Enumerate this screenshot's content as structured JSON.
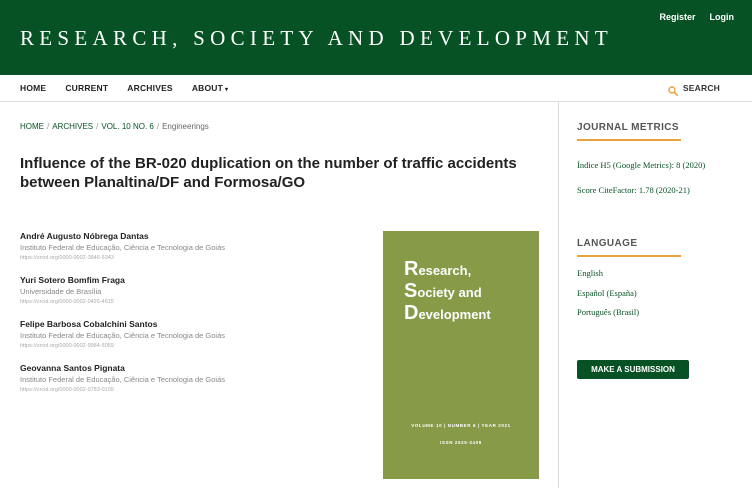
{
  "header": {
    "site_title": "RESEARCH, SOCIETY AND DEVELOPMENT",
    "register_label": "Register",
    "login_label": "Login",
    "background_color": "#075224"
  },
  "nav": {
    "items": [
      {
        "label": "HOME"
      },
      {
        "label": "CURRENT"
      },
      {
        "label": "ARCHIVES"
      },
      {
        "label": "ABOUT"
      }
    ],
    "about_caret": "▾",
    "search_label": "SEARCH",
    "search_icon": "search-icon",
    "accent_color": "#e8a33c"
  },
  "breadcrumb": {
    "items": [
      "HOME",
      "ARCHIVES",
      "VOL. 10 NO. 6"
    ],
    "separator": "/",
    "current": "Engineerings"
  },
  "article": {
    "title": "Influence of the BR-020 duplication on the number of traffic accidents between Planaltina/DF and Formosa/GO",
    "authors": [
      {
        "name": "André Augusto Nóbrega Dantas",
        "affiliation": "Instituto Federal de Educação, Ciência e Tecnologia de Goiás",
        "orcid": "https://orcid.org/0000-0002-3846-5343"
      },
      {
        "name": "Yuri Sotero Bomfim Fraga",
        "affiliation": "Universidade de Brasília",
        "orcid": "https://orcid.org/0000-0002-0426-4615"
      },
      {
        "name": "Felipe Barbosa Cobalchini Santos",
        "affiliation": "Instituto Federal de Educação, Ciência e Tecnologia de Goiás",
        "orcid": "https://orcid.org/0000-0002-9984-5059"
      },
      {
        "name": "Geovanna Santos Pignata",
        "affiliation": "Instituto Federal de Educação, Ciência e Tecnologia de Goiás",
        "orcid": "https://orcid.org/0000-0002-0783-0109"
      }
    ]
  },
  "cover": {
    "title_lines": [
      {
        "cap": "R",
        "rest": "esearch,"
      },
      {
        "cap": "S",
        "rest": "ociety and"
      },
      {
        "cap": "D",
        "rest": "evelopment"
      }
    ],
    "volume_line": "VOLUME 10 | NUMBER 6 | YEAR 2021",
    "issn_line": "ISSN 2525-3409",
    "background_color": "#869a47"
  },
  "sidebar": {
    "metrics_title": "JOURNAL METRICS",
    "metrics_links": [
      "Índice H5 (Google Metrics): 8 (2020)",
      "Score CiteFactor: 1.78 (2020-21)"
    ],
    "language_title": "LANGUAGE",
    "languages": [
      "English",
      "Español (España)",
      "Português (Brasil)"
    ],
    "submit_label": "MAKE A SUBMISSION"
  }
}
